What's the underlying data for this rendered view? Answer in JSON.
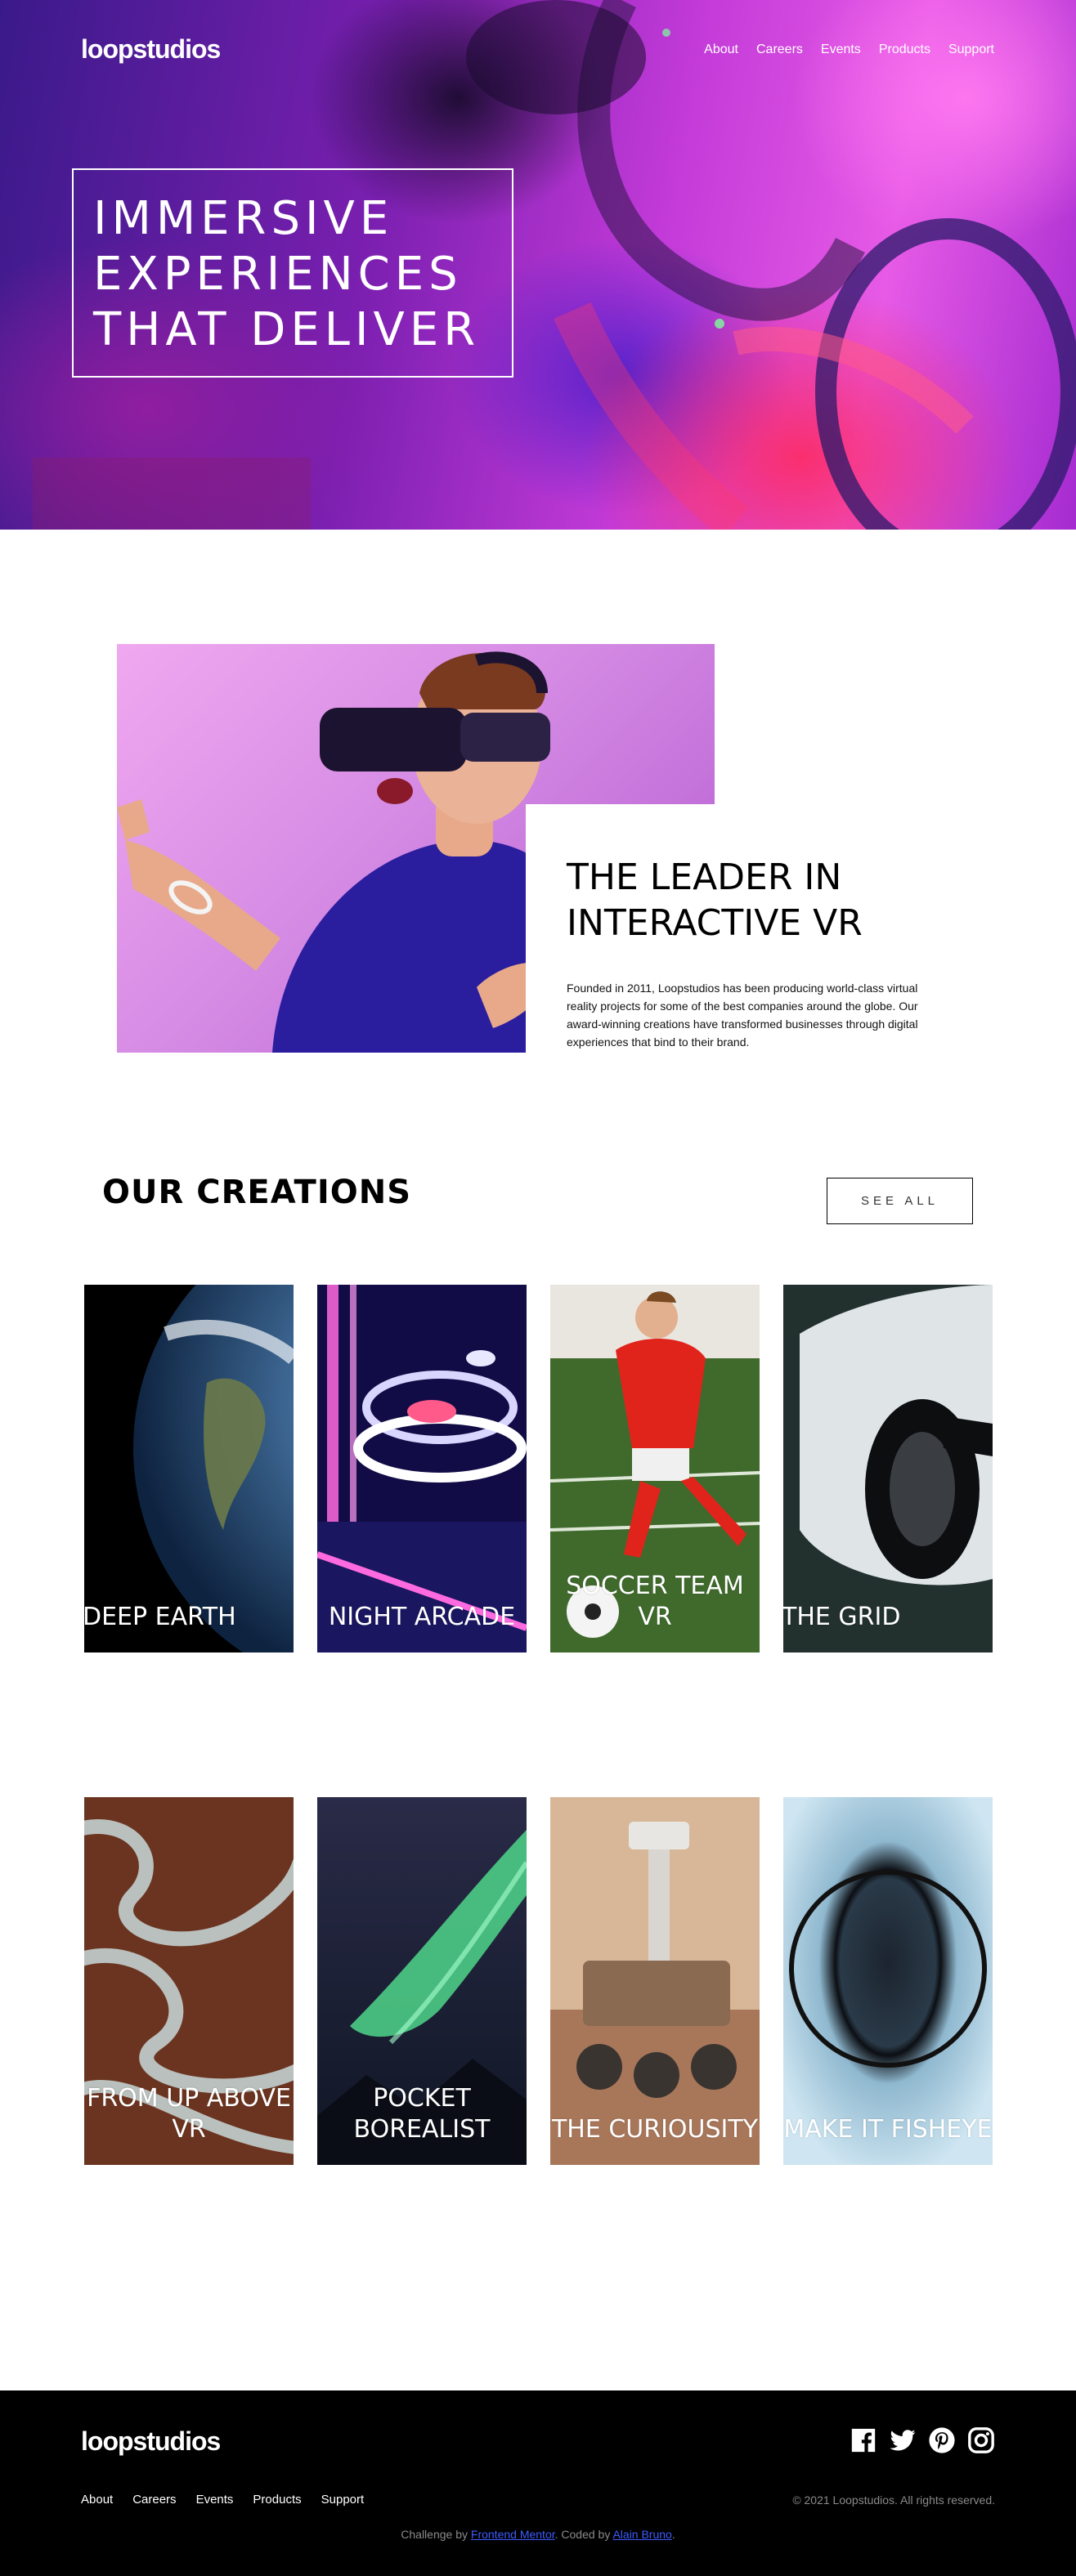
{
  "header": {
    "logo": "loopstudios",
    "nav": [
      "About",
      "Careers",
      "Events",
      "Products",
      "Support"
    ]
  },
  "hero": {
    "title_line1": "IMMERSIVE",
    "title_line2": "EXPERIENCES",
    "title_line3": "THAT DELIVER"
  },
  "leader": {
    "title_line1": "THE LEADER IN",
    "title_line2": "INTERACTIVE VR",
    "body": "Founded in 2011, Loopstudios has been producing world-class virtual reality projects for some of the best companies around the globe. Our award-winning creations have transformed businesses through digital experiences that bind to their brand."
  },
  "creations": {
    "title": "OUR CREATIONS",
    "see_all": "SEE ALL",
    "cards": [
      {
        "label": "DEEP EARTH"
      },
      {
        "label": "NIGHT ARCADE"
      },
      {
        "label": "SOCCER TEAM VR"
      },
      {
        "label": "THE GRID"
      },
      {
        "label": "FROM UP ABOVE VR"
      },
      {
        "label": "POCKET BOREALIST"
      },
      {
        "label": "THE CURIOUSITY"
      },
      {
        "label": "MAKE IT FISHEYE"
      }
    ]
  },
  "footer": {
    "logo": "loopstudios",
    "nav": [
      "About",
      "Careers",
      "Events",
      "Products",
      "Support"
    ],
    "social_icons": [
      "facebook-icon",
      "twitter-icon",
      "pinterest-icon",
      "instagram-icon"
    ],
    "copyright": "© 2021 Loopstudios. All rights reserved.",
    "attribution_prefix": "Challenge by ",
    "attribution_link1": "Frontend Mentor",
    "attribution_middle": ". Coded by ",
    "attribution_link2": "Alain Bruno",
    "attribution_suffix": "."
  },
  "colors": {
    "background": "#ffffff",
    "footer": "#000000",
    "link": "#3b5bff",
    "muted": "#8a8a8a"
  }
}
